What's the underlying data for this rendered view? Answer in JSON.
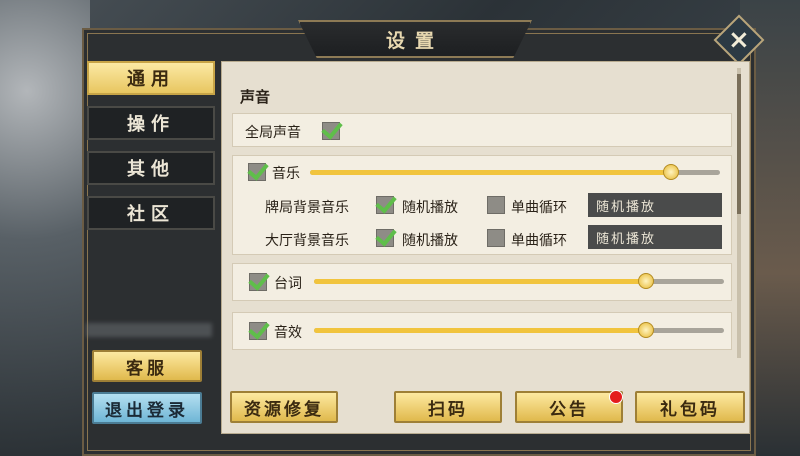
{
  "title": "设置",
  "close_icon": "×",
  "tabs": [
    {
      "label": "通用",
      "active": true
    },
    {
      "label": "操作",
      "active": false
    },
    {
      "label": "其他",
      "active": false
    },
    {
      "label": "社区",
      "active": false
    }
  ],
  "side_buttons": {
    "service": "客服",
    "logout": "退出登录"
  },
  "sound": {
    "section_title": "声音",
    "global_label": "全局声音",
    "global_checked": true,
    "music": {
      "label": "音乐",
      "checked": true,
      "level": 0.88,
      "table_bgm": {
        "label": "牌局背景音乐",
        "random_label": "随机播放",
        "random_checked": true,
        "loop_label": "单曲循环",
        "loop_checked": false,
        "selected": "随机播放"
      },
      "lobby_bgm": {
        "label": "大厅背景音乐",
        "random_label": "随机播放",
        "random_checked": true,
        "loop_label": "单曲循环",
        "loop_checked": false,
        "selected": "随机播放"
      }
    },
    "voice": {
      "label": "台词",
      "checked": true,
      "level": 0.81
    },
    "sfx": {
      "label": "音效",
      "checked": true,
      "level": 0.81
    }
  },
  "bottom_buttons": {
    "repair": "资源修复",
    "scan": "扫码",
    "notice": "公告",
    "gift": "礼包码"
  },
  "colors": {
    "accent_gold": "#f1c43d",
    "check_green": "#5fbe4a",
    "notice_dot": "#e41d1d"
  }
}
